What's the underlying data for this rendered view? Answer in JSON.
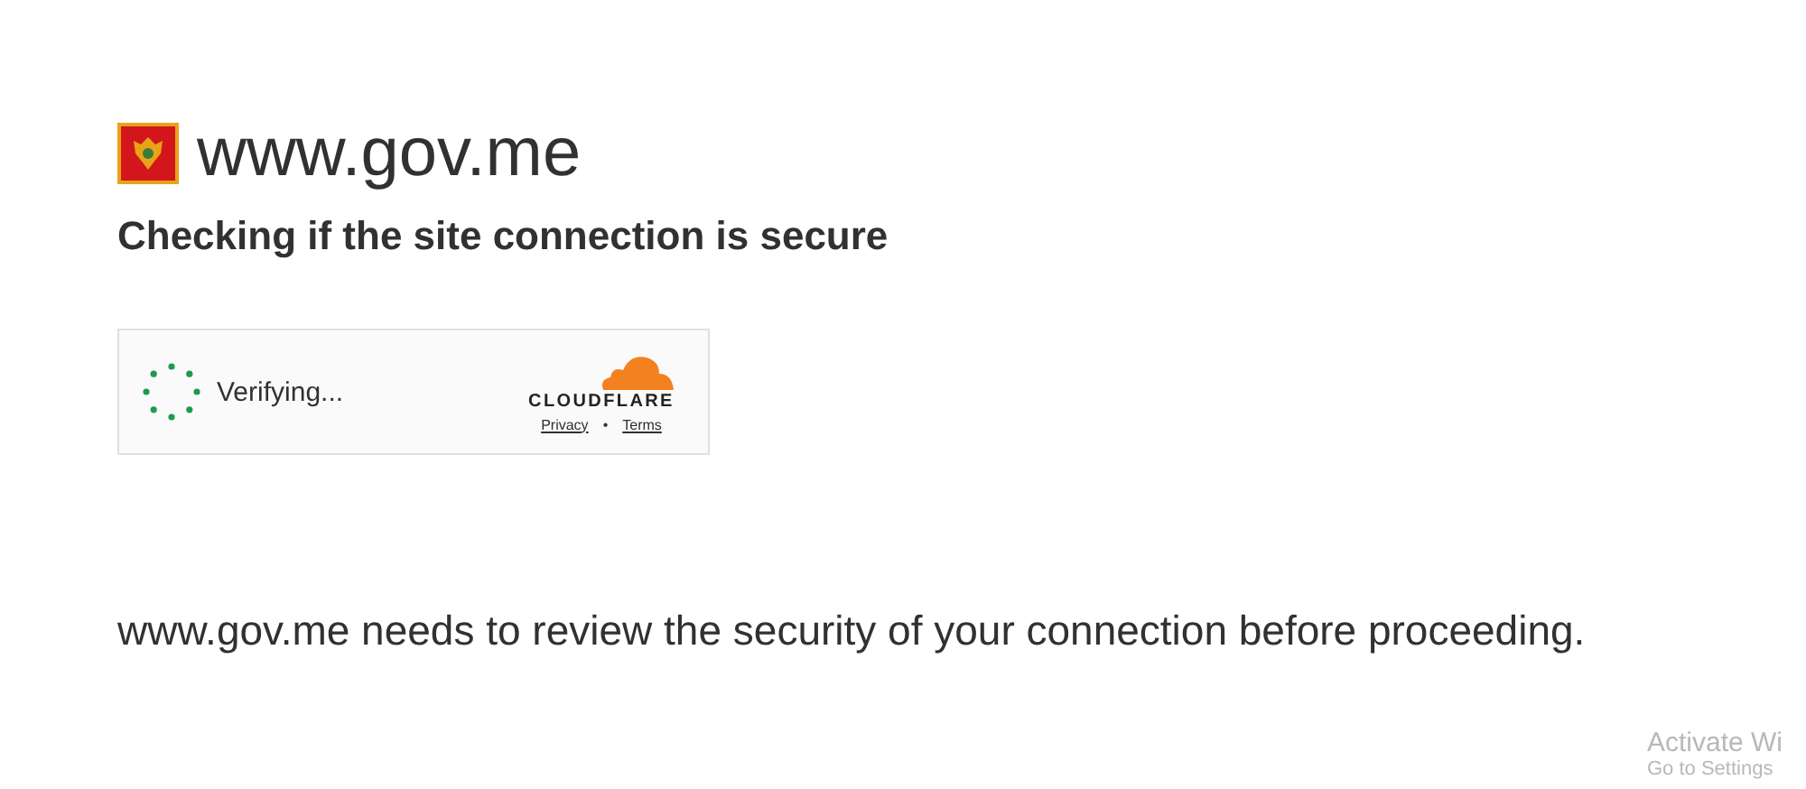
{
  "site": {
    "domain": "www.gov.me"
  },
  "heading": "Checking if the site connection is secure",
  "widget": {
    "status": "Verifying...",
    "brand": "CLOUDFLARE",
    "links": [
      {
        "label": "Privacy"
      },
      {
        "label": "Terms"
      }
    ],
    "separator": "•"
  },
  "message": "www.gov.me needs to review the security of your connection before proceeding.",
  "os_overlay": {
    "title": "Activate Wi",
    "subtitle": "Go to Settings"
  }
}
